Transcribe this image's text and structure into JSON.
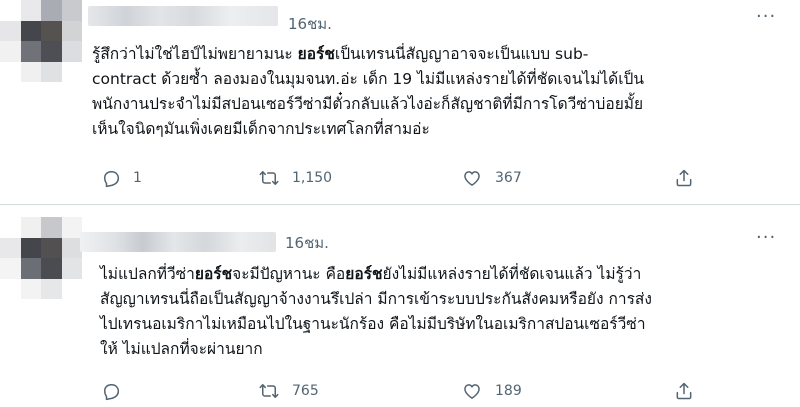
{
  "tweets": [
    {
      "time": "16ชม.",
      "more": "···",
      "lines": [
        {
          "pre": "รู้สึกว่าไม่ใช่ไฮป์ไม่พยายามนะ ",
          "bold": "ยอร์ช",
          "post": "เป็นเทรนนี่สัญญาอาจจะเป็นแบบ sub-"
        },
        {
          "pre": "contract ด้วยซ้ำ ลองมองในมุมจนท.อ่ะ เด็ก 19 ไม่มีแหล่งรายได้ที่ชัดเจนไม่ได้เป็น",
          "bold": "",
          "post": ""
        },
        {
          "pre": "พนักงานประจำไม่มีสปอนเซอร์วีซ่ามีตั๋วกลับแล้วไงอ่ะก็สัญชาติที่มีการโดวีซ่าบ่อยมั้ย",
          "bold": "",
          "post": ""
        },
        {
          "pre": "เห็นใจนิดๆมันเพิ่งเคยมีเด็กจากประเทศโลกที่สามอ่ะ",
          "bold": "",
          "post": ""
        }
      ],
      "replies": "1",
      "retweets": "1,150",
      "likes": "367"
    },
    {
      "time": "16ชม.",
      "more": "···",
      "lines": [
        {
          "pre": "ไม่แปลกที่วีซ่า",
          "bold": "ยอร์ช",
          "post": "จะมีปัญหานะ คือ",
          "bold2": "ยอร์ช",
          "post2": "ยังไม่มีแหล่งรายได้ที่ชัดเจนแล้ว ไม่รู้ว่า"
        },
        {
          "pre": "สัญญาเทรนนี่ถือเป็นสัญญาจ้างงานรึเปล่า มีการเข้าระบบประกันสังคมหรือยัง การส่ง",
          "bold": "",
          "post": ""
        },
        {
          "pre": "ไปเทรนอเมริกาไม่เหมือนไปในฐานะนักร้อง คือไม่มีบริษัทในอเมริกาสปอนเซอร์วีซ่า",
          "bold": "",
          "post": ""
        },
        {
          "pre": "ให้ ไม่แปลกที่จะผ่านยาก",
          "bold": "",
          "post": ""
        }
      ],
      "replies": "",
      "retweets": "765",
      "likes": "189"
    }
  ],
  "icons": {
    "reply": "reply-icon",
    "retweet": "retweet-icon",
    "like": "like-icon",
    "share": "share-icon",
    "more": "more-options-icon"
  },
  "colors": {
    "text": "#0f1419",
    "secondary": "#536471",
    "divider": "#d5dadd"
  }
}
